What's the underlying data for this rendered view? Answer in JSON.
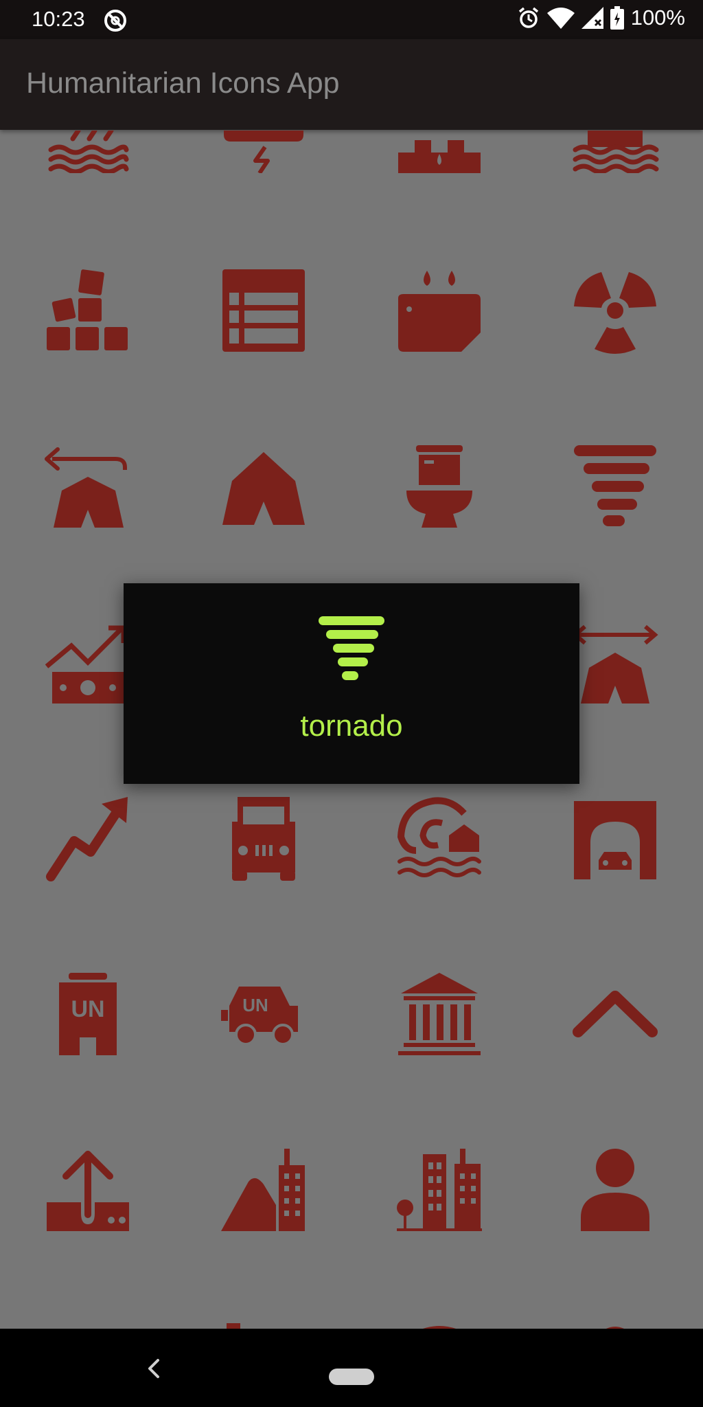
{
  "status_bar": {
    "time": "10:23",
    "battery": "100%",
    "icons": [
      "do-not-disturb-icon",
      "alarm-icon",
      "wifi-icon",
      "signal-icon",
      "battery-icon"
    ]
  },
  "app_bar": {
    "title": "Humanitarian Icons App"
  },
  "colors": {
    "icon_red": "#7b211b",
    "background": "#777777",
    "accent_green": "#b3ef4a",
    "dialog_bg": "#0b0b0b"
  },
  "icons": [
    "flood-icon",
    "storm-icon",
    "water-facility-icon",
    "flood-house-icon",
    "blocks-icon",
    "table-icon",
    "water-supply-icon",
    "radiation-icon",
    "return-shelter-icon",
    "tent-icon",
    "toilet-icon",
    "tornado-icon",
    "money-growth-icon",
    "train-icon",
    "teacher-icon",
    "shelter-move-icon",
    "trend-up-icon",
    "truck-icon",
    "tsunami-icon",
    "tunnel-icon",
    "un-building-icon",
    "un-vehicle-icon",
    "university-icon",
    "chevron-up-icon",
    "upload-icon",
    "urban-rural-icon",
    "urban-icon",
    "user-icon"
  ],
  "dialog": {
    "label": "tornado",
    "icon": "tornado-icon"
  },
  "nav_bar": {
    "back": "back-icon",
    "home": "home-pill"
  }
}
